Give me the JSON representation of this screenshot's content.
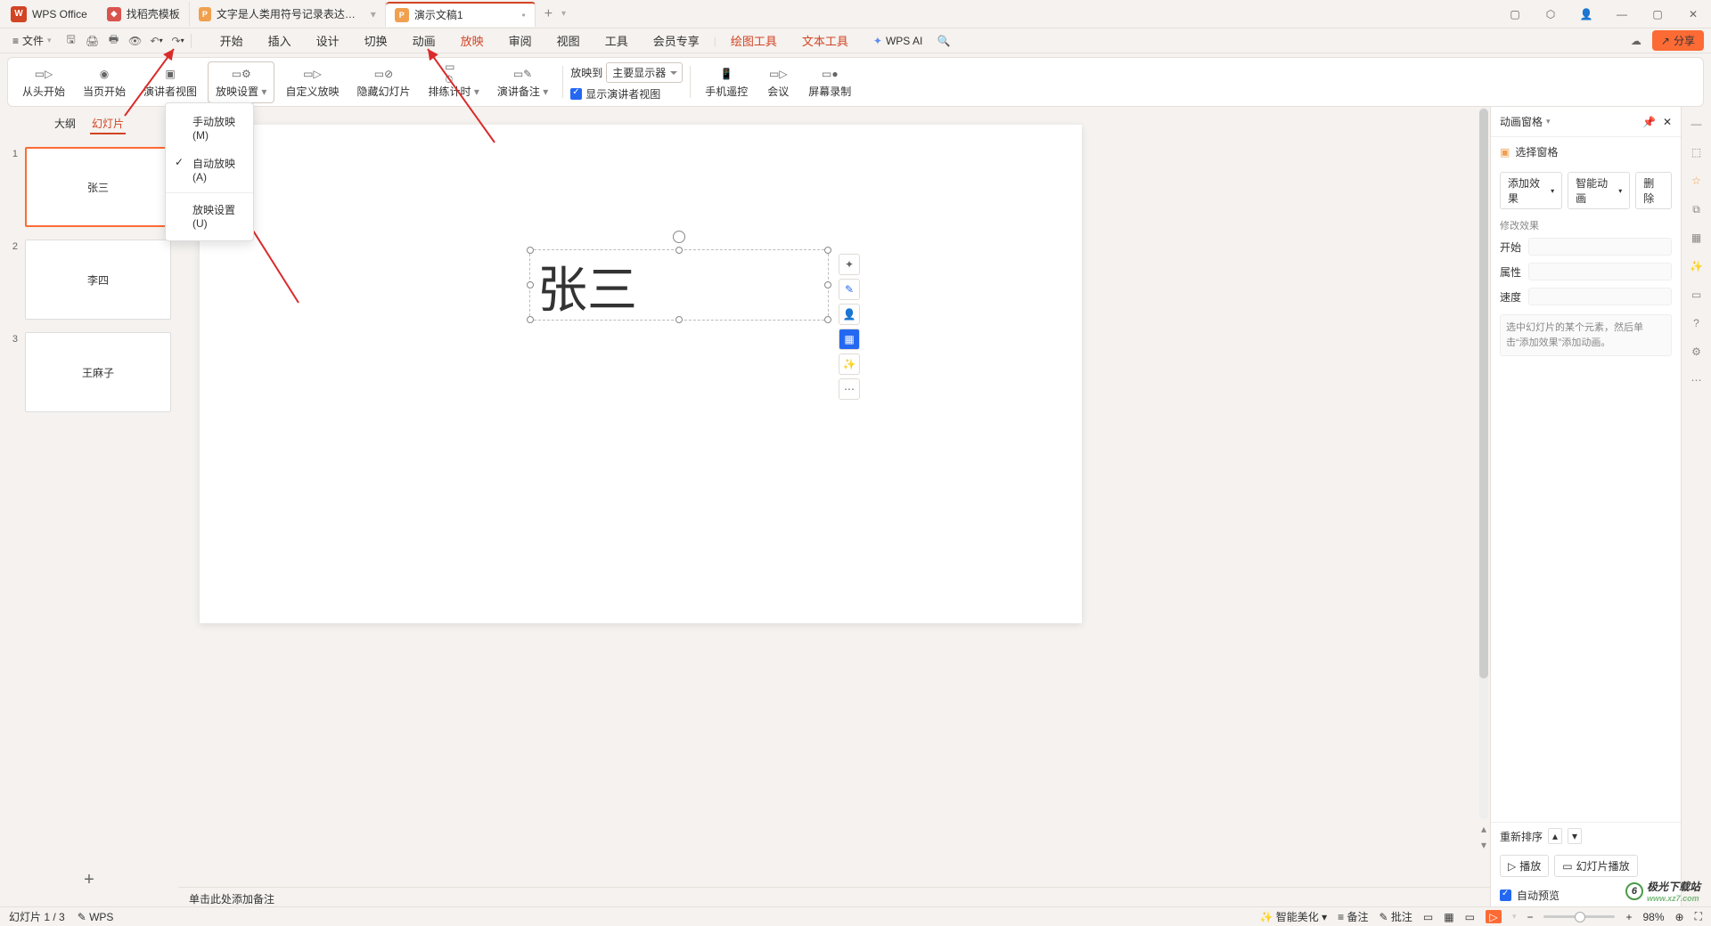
{
  "titlebar": {
    "app": "WPS Office",
    "tabs": [
      {
        "icon": "red",
        "label": "找稻壳模板"
      },
      {
        "icon": "orange",
        "label": "文字是人类用符号记录表达信息以..."
      },
      {
        "icon": "orange",
        "label": "演示文稿1",
        "active": true
      }
    ]
  },
  "menubar": {
    "file": "文件",
    "tabs": [
      "开始",
      "插入",
      "设计",
      "切换",
      "动画",
      "放映",
      "审阅",
      "视图",
      "工具",
      "会员专享"
    ],
    "extra": [
      "绘图工具",
      "文本工具"
    ],
    "active": "放映",
    "ai": "WPS AI",
    "share": "分享"
  },
  "ribbon": {
    "items": [
      {
        "label": "从头开始"
      },
      {
        "label": "当页开始"
      },
      {
        "label": "演讲者视图"
      }
    ],
    "settings_label": "放映设置",
    "items2": [
      {
        "label": "自定义放映"
      },
      {
        "label": "隐藏幻灯片"
      },
      {
        "label": "排练计时"
      },
      {
        "label": "演讲备注"
      }
    ],
    "play_to": "放映到",
    "display": "主要显示器",
    "show_presenter": "显示演讲者视图",
    "items3": [
      {
        "label": "手机遥控"
      },
      {
        "label": "会议"
      },
      {
        "label": "屏幕录制"
      }
    ]
  },
  "dropdown": {
    "manual": "手动放映(M)",
    "auto": "自动放映(A)",
    "settings": "放映设置(U)"
  },
  "outline": {
    "tab_outline": "大纲",
    "tab_slides": "幻灯片",
    "slides": [
      {
        "num": "1",
        "text": "张三",
        "active": true
      },
      {
        "num": "2",
        "text": "李四"
      },
      {
        "num": "3",
        "text": "王麻子"
      }
    ]
  },
  "canvas": {
    "text": "张三",
    "notes_placeholder": "单击此处添加备注"
  },
  "anim": {
    "title": "动画窗格",
    "select_pane": "选择窗格",
    "add_effect": "添加效果",
    "smart": "智能动画",
    "delete": "删除",
    "modify": "修改效果",
    "p_start": "开始",
    "p_attr": "属性",
    "p_speed": "速度",
    "hint": "选中幻灯片的某个元素，然后单击“添加效果”添加动画。",
    "reorder": "重新排序",
    "play": "播放",
    "slideshow": "幻灯片播放",
    "autoprev": "自动预览"
  },
  "status": {
    "slide": "幻灯片 1 / 3",
    "wps": "WPS",
    "beautify": "智能美化",
    "notes": "备注",
    "comments": "批注",
    "zoom": "98%"
  },
  "watermark": {
    "brand": "极光下载站",
    "url": "www.xz7.com"
  }
}
